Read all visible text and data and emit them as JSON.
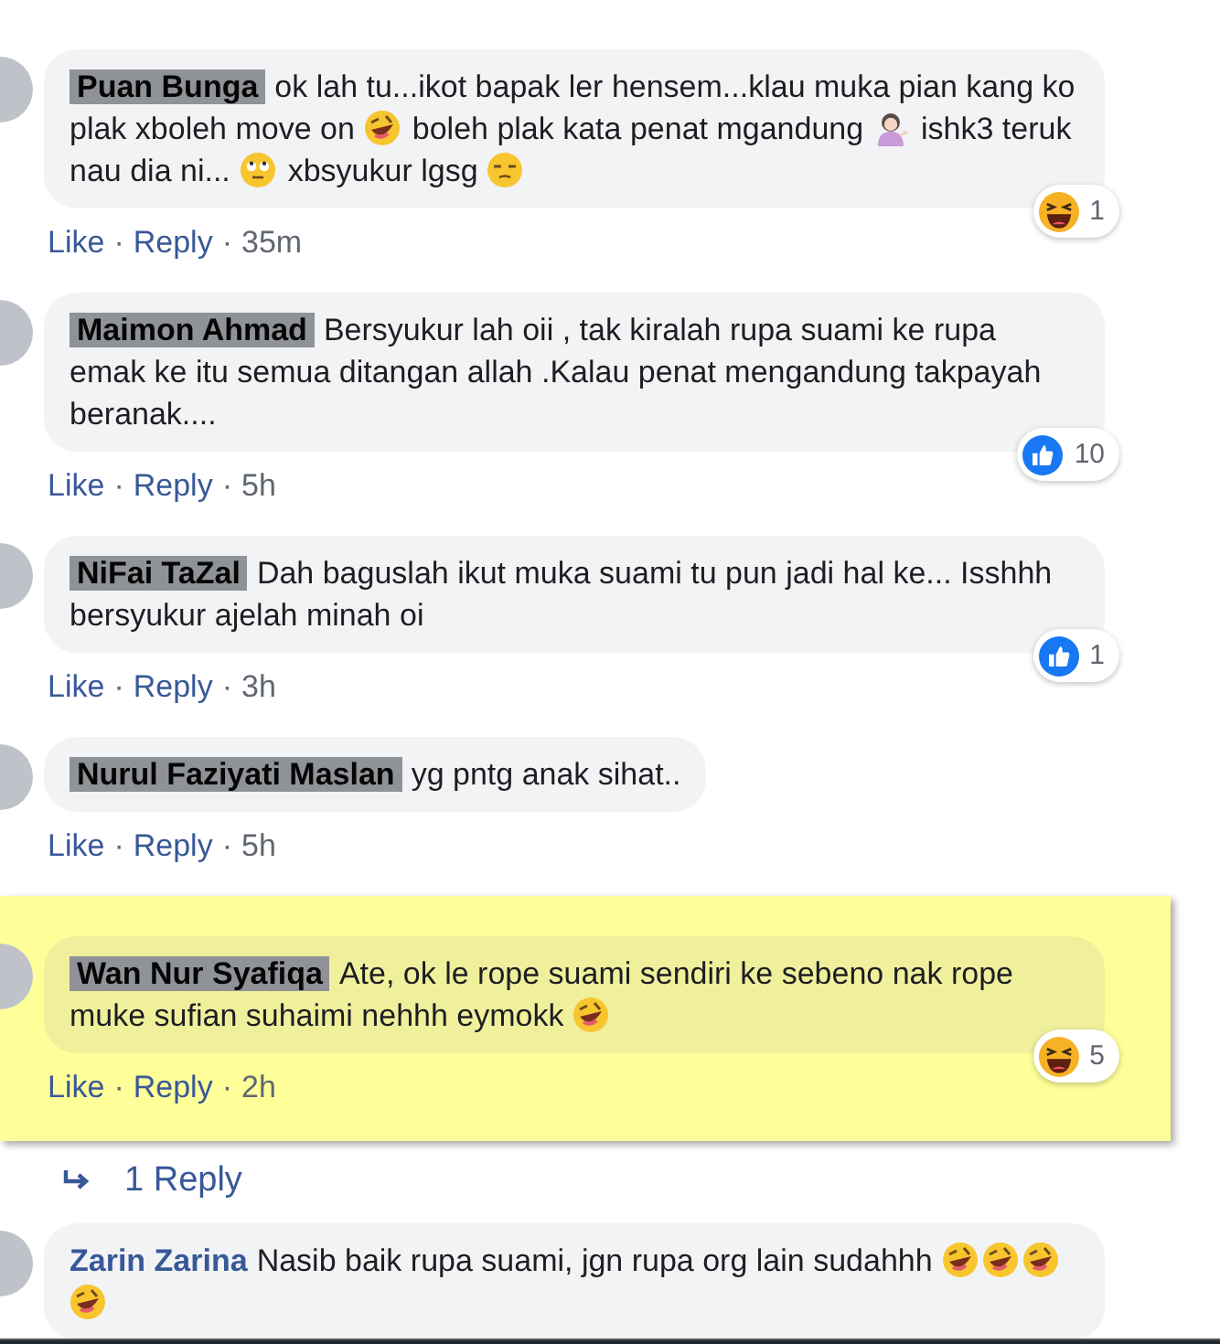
{
  "comments": [
    {
      "name": "Puan Bunga",
      "redacted": true,
      "highlighted": false,
      "parts": [
        {
          "kind": "text",
          "text": "ok lah tu...ikot bapak ler hensem...klau muka pian kang ko plak xboleh move on "
        },
        {
          "kind": "rofl"
        },
        {
          "kind": "text",
          "text": " boleh plak kata penat mgandung "
        },
        {
          "kind": "woman"
        },
        {
          "kind": "text",
          "text": " ishk3 teruk nau dia ni... "
        },
        {
          "kind": "eyeroll"
        },
        {
          "kind": "text",
          "text": " xbsyukur lgsg "
        },
        {
          "kind": "unamused"
        }
      ],
      "like": "Like",
      "reply": "Reply",
      "separator": "·",
      "time": "35m",
      "reaction": {
        "kind": "haha",
        "count": "1"
      }
    },
    {
      "name": "Maimon Ahmad",
      "redacted": true,
      "highlighted": false,
      "parts": [
        {
          "kind": "text",
          "text": "Bersyukur lah oii , tak kiralah rupa suami ke rupa emak ke itu semua ditangan allah .Kalau penat mengandung takpayah beranak...."
        }
      ],
      "like": "Like",
      "reply": "Reply",
      "separator": "·",
      "time": "5h",
      "reaction": {
        "kind": "like",
        "count": "10"
      }
    },
    {
      "name": "NiFai TaZal",
      "redacted": true,
      "highlighted": false,
      "parts": [
        {
          "kind": "text",
          "text": "Dah baguslah ikut muka suami tu pun jadi hal ke... Isshhh bersyukur ajelah minah oi"
        }
      ],
      "like": "Like",
      "reply": "Reply",
      "separator": "·",
      "time": "3h",
      "reaction": {
        "kind": "like",
        "count": "1"
      }
    },
    {
      "name": "Nurul Faziyati Maslan",
      "redacted": true,
      "highlighted": false,
      "parts": [
        {
          "kind": "text",
          "text": "yg pntg anak sihat.."
        }
      ],
      "like": "Like",
      "reply": "Reply",
      "separator": "·",
      "time": "5h"
    },
    {
      "name": "Wan Nur Syafiqa",
      "redacted": true,
      "highlighted": true,
      "parts": [
        {
          "kind": "text",
          "text": "Ate, ok le rope suami sendiri ke sebeno nak rope muke sufian suhaimi nehhh eymokk "
        },
        {
          "kind": "rofl"
        }
      ],
      "like": "Like",
      "reply": "Reply",
      "separator": "·",
      "time": "2h",
      "reaction": {
        "kind": "haha",
        "count": "5"
      },
      "replies_link": "1 Reply"
    },
    {
      "name": "Zarin Zarina",
      "redacted": false,
      "highlighted": false,
      "parts": [
        {
          "kind": "text",
          "text": "Nasib baik rupa suami, jgn rupa org lain sudahhh "
        },
        {
          "kind": "rofl"
        },
        {
          "kind": "rofl"
        },
        {
          "kind": "rofl"
        },
        {
          "kind": "rofl"
        }
      ]
    }
  ]
}
